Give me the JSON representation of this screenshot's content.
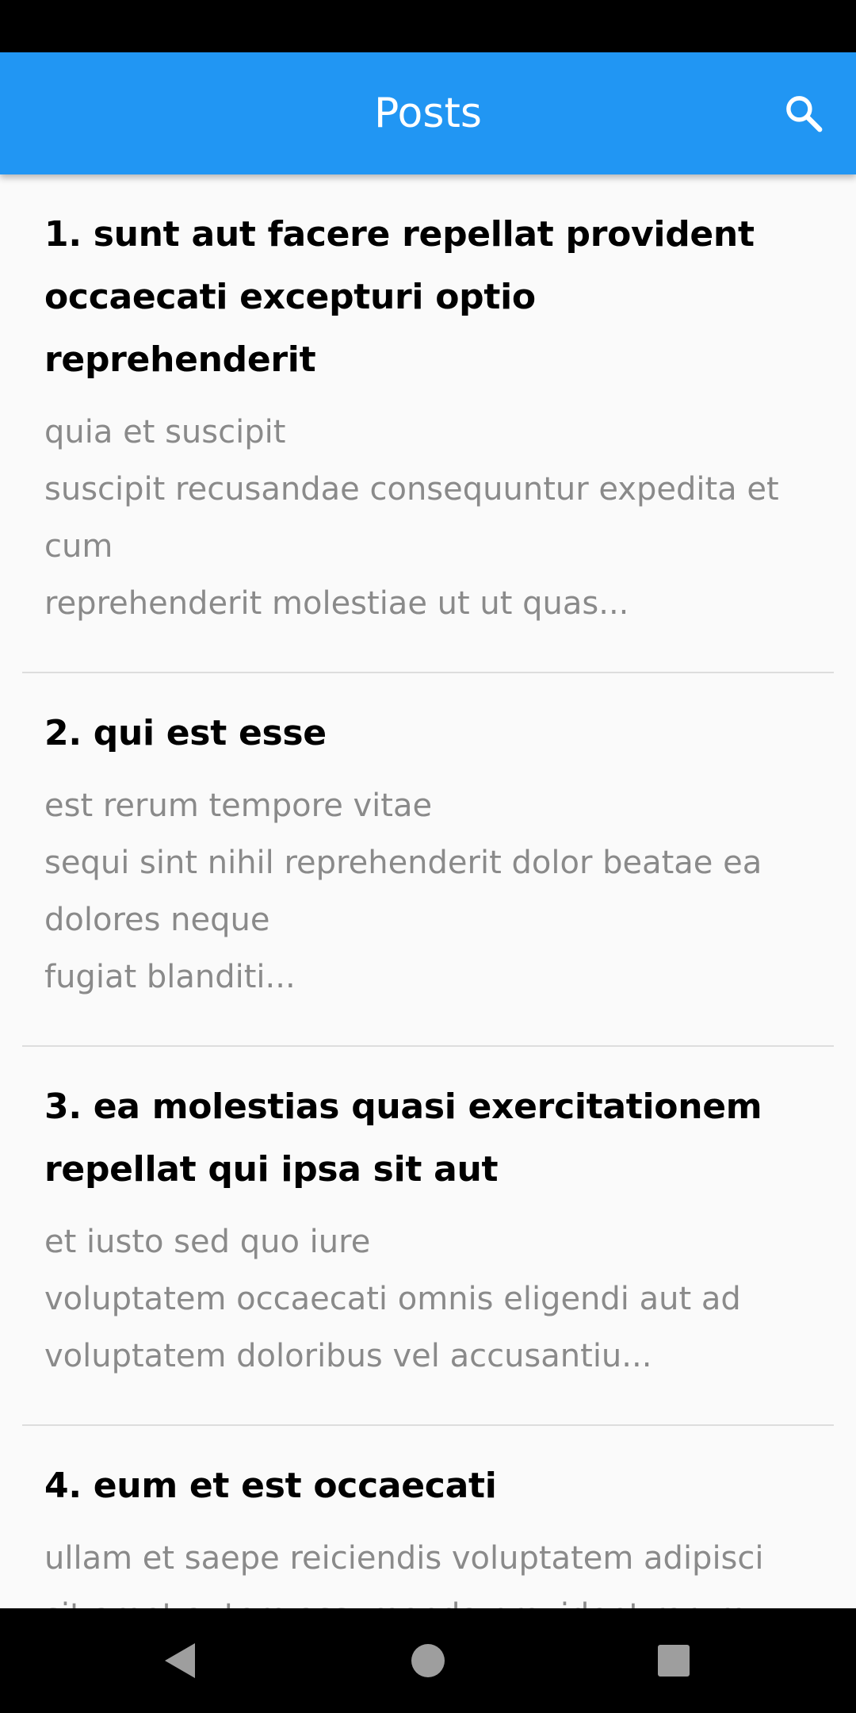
{
  "colors": {
    "accent": "#2196f3",
    "title_text": "#000000",
    "body_text": "#8a8a8a",
    "divider": "#dddddd",
    "background": "#fafafa"
  },
  "app_bar": {
    "title": "Posts",
    "search_icon": "search-icon"
  },
  "posts": [
    {
      "title": "1. sunt aut facere repellat provident occaecati excepturi optio reprehenderit",
      "body": "quia et suscipit\nsuscipit recusandae consequuntur expedita et cum\nreprehenderit molestiae ut ut quas..."
    },
    {
      "title": "2. qui est esse",
      "body": "est rerum tempore vitae\nsequi sint nihil reprehenderit dolor beatae ea dolores neque\nfugiat blanditi..."
    },
    {
      "title": "3. ea molestias quasi exercitationem repellat qui ipsa sit aut",
      "body": "et iusto sed quo iure\nvoluptatem occaecati omnis eligendi aut ad\nvoluptatem doloribus vel accusantiu..."
    },
    {
      "title": "4. eum et est occaecati",
      "body": "ullam et saepe reiciendis voluptatem adipisci\nsit amet autem assumenda provident rerum"
    }
  ],
  "nav_bar": {
    "back_icon": "back-triangle-icon",
    "home_icon": "home-circle-icon",
    "recent_icon": "recent-apps-square-icon"
  }
}
